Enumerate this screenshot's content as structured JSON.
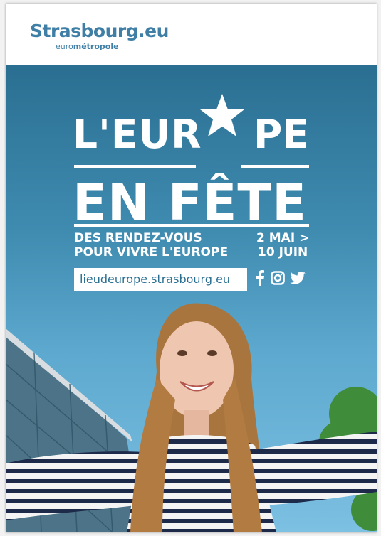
{
  "header": {
    "logo_name": "Strasbourg.eu",
    "logo_sub_prefix": "euro",
    "logo_sub_bold": "métropole"
  },
  "title": {
    "line1_left": "L'EUR",
    "line1_right": "PE",
    "line2": "EN FÊTE"
  },
  "subtitle": {
    "line1": "DES RENDEZ-VOUS",
    "line2": "POUR VIVRE L'EUROPE"
  },
  "dates": {
    "line1": "2 MAI >",
    "line2": "10 JUIN"
  },
  "website": "lieudeurope.strasbourg.eu",
  "social": [
    "facebook-icon",
    "instagram-icon",
    "twitter-icon"
  ],
  "colors": {
    "brand_blue": "#3f7fa6",
    "sky_top": "#2a6f92",
    "sky_bottom": "#7cc0e2",
    "text_white": "#ffffff"
  }
}
